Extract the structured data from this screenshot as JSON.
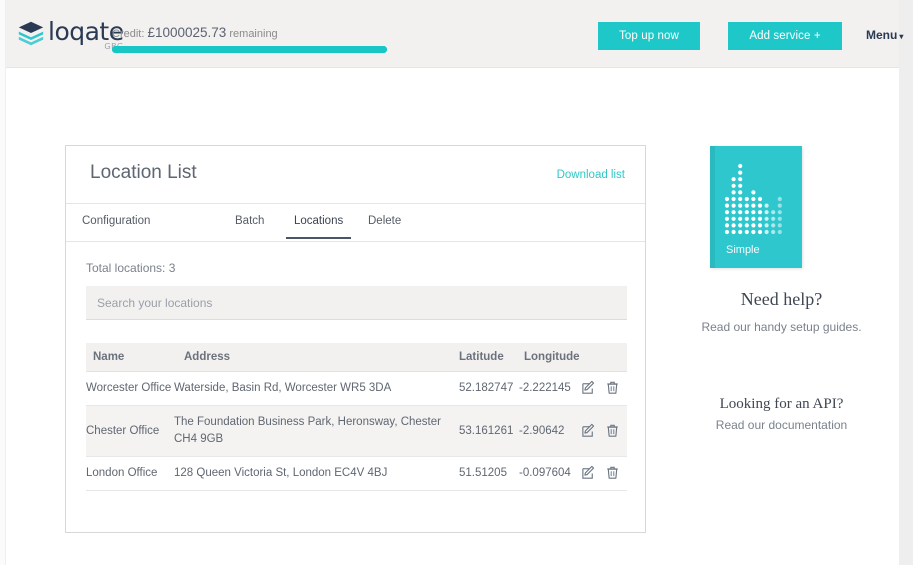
{
  "header": {
    "logo": {
      "word": "loqate",
      "sub": "GBG",
      "icon": "loqate-logo-icon"
    },
    "credit": {
      "label": "Credit:",
      "amount": "£1000025.73",
      "suffix": "remaining",
      "full_text": "Credit: £1000025.73 remaining",
      "bar_percent": 100
    },
    "buttons": {
      "top_up": "Top up now",
      "add_service": "Add service +",
      "menu": "Menu",
      "menu_caret": "▾"
    },
    "colors": {
      "accent": "#1ec8c8",
      "bar": "#19c6c6",
      "bg": "#f2f1f0"
    }
  },
  "card": {
    "title": "Location List",
    "download_link": "Download list",
    "tabs": [
      {
        "label": "Configuration",
        "active": false
      },
      {
        "label": "Batch",
        "active": false
      },
      {
        "label": "Locations",
        "active": true
      },
      {
        "label": "Delete",
        "active": false
      }
    ],
    "total_locations_label": "Total locations:",
    "total_locations_count": "3",
    "search": {
      "placeholder": "Search your locations",
      "value": ""
    },
    "table": {
      "columns": [
        "Name",
        "Address",
        "Latitude",
        "Longitude",
        ""
      ],
      "rows": [
        {
          "name": "Worcester Office",
          "address": "Waterside, Basin Rd, Worcester WR5 3DA",
          "latitude": "52.182747",
          "longitude": "-2.222145"
        },
        {
          "name": "Chester Office",
          "address": "The Foundation Business Park, Heronsway, Chester CH4 9GB",
          "latitude": "53.161261",
          "longitude": "-2.90642"
        },
        {
          "name": "London Office",
          "address": "128 Queen Victoria St, London EC4V 4BJ",
          "latitude": "51.51205",
          "longitude": "-0.097604"
        }
      ],
      "row_actions": {
        "edit": "edit-icon",
        "delete": "trash-icon"
      }
    }
  },
  "sidebar": {
    "promo": {
      "label": "Simple",
      "color": "#2ec7ce"
    },
    "help_title": "Need help?",
    "help_sub": "Read our handy setup guides.",
    "api_title": "Looking for an API?",
    "api_sub": "Read our documentation"
  }
}
